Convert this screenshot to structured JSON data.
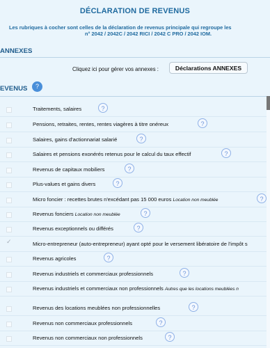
{
  "header": {
    "title": "DÉCLARATION DE REVENUS",
    "intro_line1": "Les rubriques à cocher sont celles de la déclaration de revenus principale qui regroupe les",
    "intro_line2": "n° 2042 / 2042C / 2042 RICI / 2042 C PRO / 2042 IOM."
  },
  "annexes": {
    "section_label": "ANNEXES",
    "prompt": "Cliquez ici pour gérer vos annexes :",
    "button_label": "Déclarations ANNEXES"
  },
  "revenus": {
    "section_label": "EVENUS",
    "help_icon": "?",
    "items": [
      {
        "label": "Traitements, salaires",
        "note": "",
        "checked": false
      },
      {
        "label": "Pensions, retraites, rentes, rentes viagères à titre onéreux",
        "note": "",
        "checked": false
      },
      {
        "label": "Salaires, gains d'actionnariat salarié",
        "note": "",
        "checked": false
      },
      {
        "label": "Salaires et pensions exonérés retenus pour le calcul du taux effectif",
        "note": "",
        "checked": false
      },
      {
        "label": "Revenus de capitaux mobiliers",
        "note": "",
        "checked": false
      },
      {
        "label": "Plus-values et gains divers",
        "note": "",
        "checked": false
      },
      {
        "label": "Micro foncier : recettes brutes n'excédant pas 15 000 euros",
        "note": "Location non meublée",
        "checked": false
      },
      {
        "label": "Revenus fonciers",
        "note": "Location non meublée",
        "checked": false
      },
      {
        "label": "Revenus exceptionnels ou différés",
        "note": "",
        "checked": false
      },
      {
        "label": "Micro-entrepreneur (auto-entrepreneur) ayant opté pour le versement libératoire de l'impôt s",
        "note": "",
        "checked": true
      },
      {
        "label": "Revenus agricoles",
        "note": "",
        "checked": false
      },
      {
        "label": "Revenus industriels et commerciaux professionnels",
        "note": "",
        "checked": false
      },
      {
        "label": "Revenus industriels et commerciaux non professionnels",
        "note": "Autres que les locations meublées n",
        "checked": false
      },
      {
        "label": "Revenus des locations meublées non professionnelles",
        "note": "",
        "checked": false
      },
      {
        "label": "Revenus non commerciaux professionnels",
        "note": "",
        "checked": false
      },
      {
        "label": "Revenus non commerciaux non professionnels",
        "note": "",
        "checked": false
      }
    ]
  }
}
